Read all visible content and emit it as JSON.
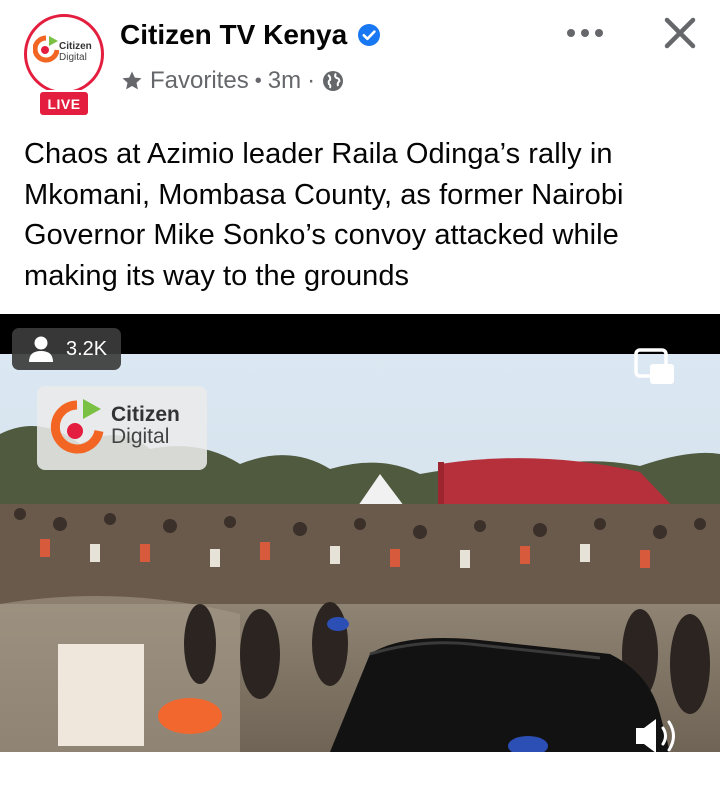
{
  "post": {
    "page_name": "Citizen TV Kenya",
    "avatar_text_line1": "Citizen",
    "avatar_text_line2": "Digital",
    "live_badge": "LIVE",
    "audience_label": "Favorites",
    "separator": "·",
    "time_ago": "3m",
    "caption": "Chaos at Azimio leader Raila Odinga’s rally in Mkomani, Mombasa County, as former Nairobi Governor Mike Sonko’s convoy attacked while making its way to the grounds"
  },
  "icons": {
    "verified": "verified-badge-icon",
    "more": "more-horizontal-icon",
    "close": "close-icon",
    "star": "star-icon",
    "globe": "globe-icon",
    "viewer": "person-icon",
    "pip": "picture-in-picture-icon",
    "volume": "volume-icon"
  },
  "video": {
    "viewer_count": "3.2K",
    "watermark_line1": "Citizen",
    "watermark_line2": "Digital"
  },
  "colors": {
    "live_red": "#e41e3f",
    "verified_blue": "#1877f2",
    "secondary_text": "#65676b",
    "brand_orange": "#f26522",
    "brand_green": "#7ac143"
  }
}
